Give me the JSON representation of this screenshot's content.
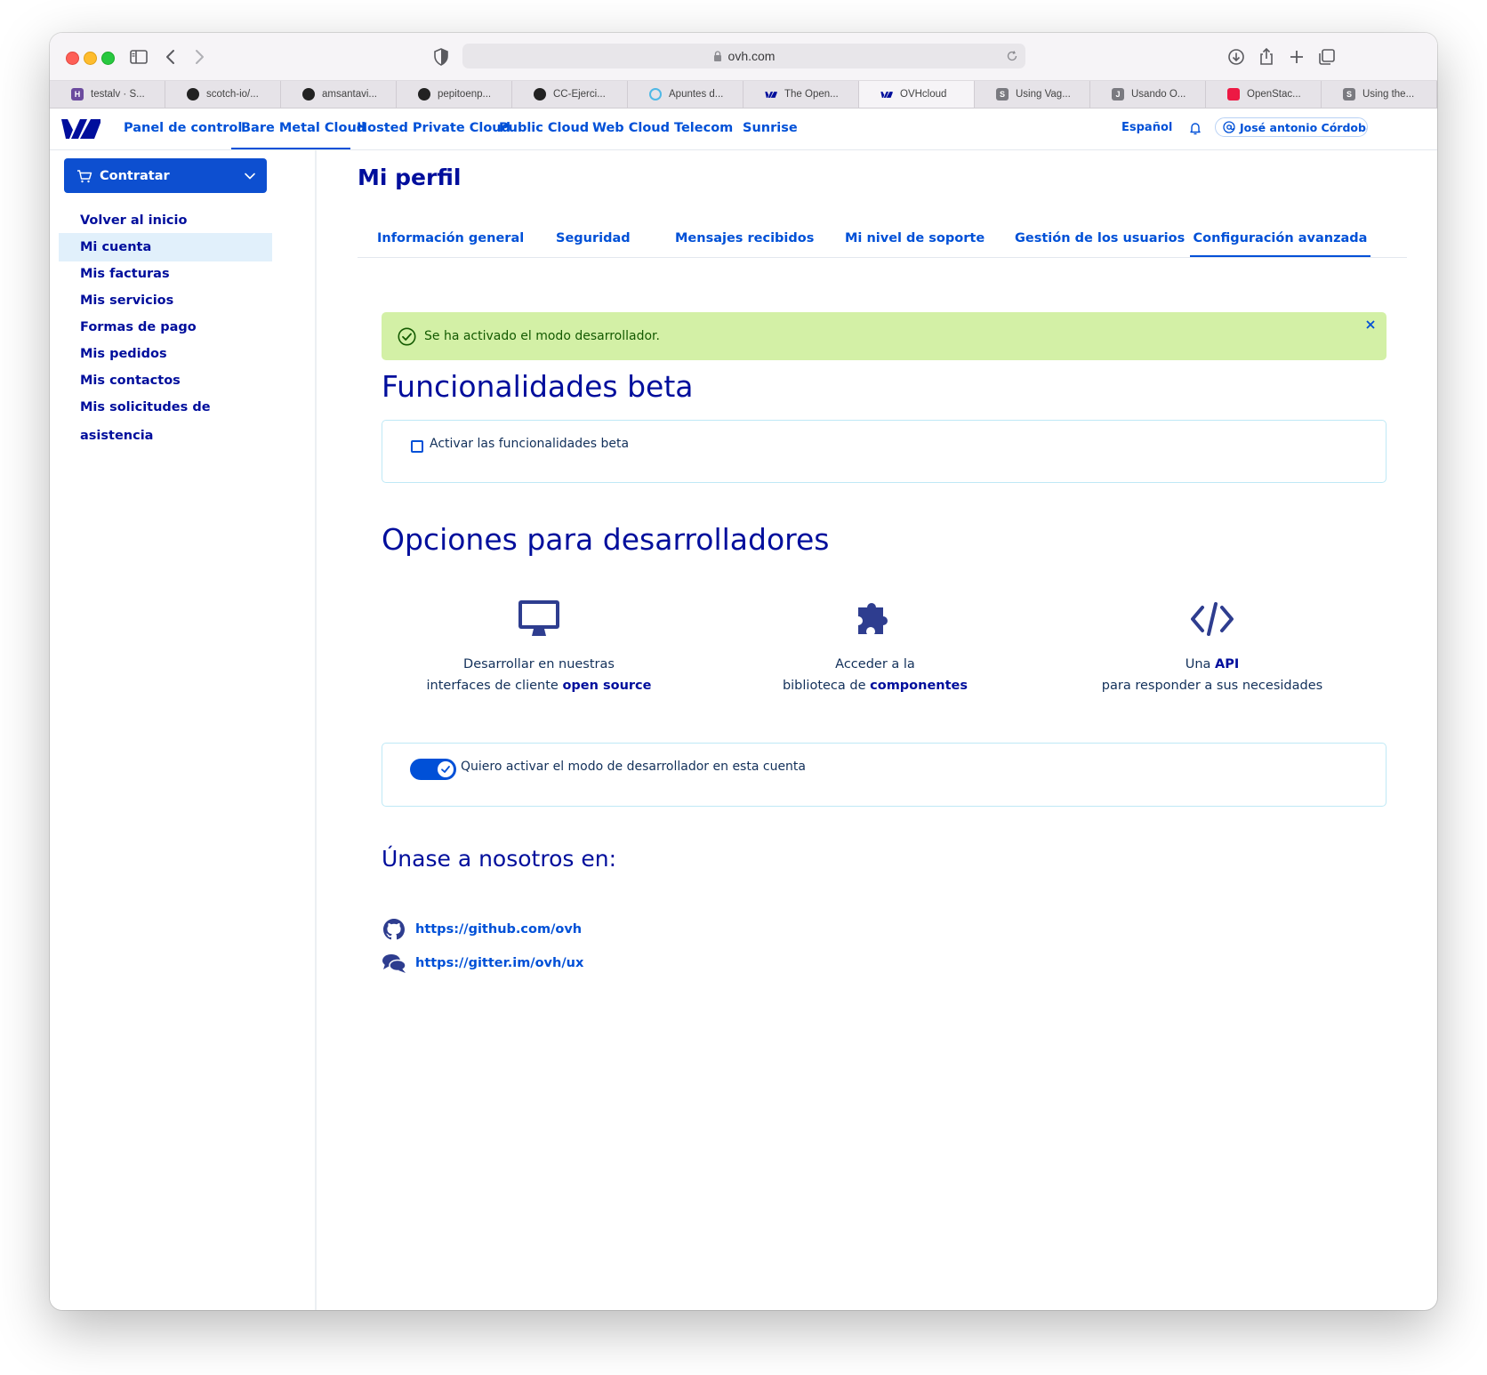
{
  "browser": {
    "url": "ovh.com",
    "tabs": [
      {
        "title": "testalv · S...",
        "favicon": "heroku-icon",
        "color": "#6b4a9e",
        "letter": "H"
      },
      {
        "title": "scotch-io/...",
        "favicon": "github-icon",
        "color": "#222222",
        "letter": ""
      },
      {
        "title": "amsantavi...",
        "favicon": "github-icon",
        "color": "#222222",
        "letter": ""
      },
      {
        "title": "pepitoenp...",
        "favicon": "github-icon",
        "color": "#222222",
        "letter": ""
      },
      {
        "title": "CC-Ejerci...",
        "favicon": "github-icon",
        "color": "#222222",
        "letter": ""
      },
      {
        "title": "Apuntes d...",
        "favicon": "cloud-icon",
        "color": "#4fb8e6",
        "letter": ""
      },
      {
        "title": "The Open...",
        "favicon": "ovh-icon",
        "color": "#000e9c",
        "letter": ""
      },
      {
        "title": "OVHcloud",
        "favicon": "ovh-icon",
        "color": "#000e9c",
        "letter": "",
        "active": true
      },
      {
        "title": "Using Vag...",
        "favicon": "s-icon",
        "color": "#7a7a80",
        "letter": "S"
      },
      {
        "title": "Usando O...",
        "favicon": "j-icon",
        "color": "#7a7a80",
        "letter": "J"
      },
      {
        "title": "OpenStac...",
        "favicon": "openstack-icon",
        "color": "#ed1944",
        "letter": ""
      },
      {
        "title": "Using the...",
        "favicon": "s-icon",
        "color": "#7a7a80",
        "letter": "S"
      }
    ]
  },
  "topnav": {
    "items": [
      "Panel de control",
      "Bare Metal Cloud",
      "Hosted Private Cloud",
      "Public Cloud",
      "Web Cloud",
      "Telecom",
      "Sunrise"
    ],
    "active": "Bare Metal Cloud",
    "language": "Español",
    "user": "José antonio Córdoba..."
  },
  "sidebar": {
    "order_button": "Contratar",
    "items": [
      "Volver al inicio",
      "Mi cuenta",
      "Mis facturas",
      "Mis servicios",
      "Formas de pago",
      "Mis pedidos",
      "Mis contactos",
      "Mis solicitudes de asistencia"
    ],
    "active": "Mi cuenta"
  },
  "main": {
    "title": "Mi perfil",
    "tabs": [
      "Información general",
      "Seguridad",
      "Mensajes recibidos",
      "Mi nivel de soporte",
      "Gestión de los usuarios",
      "Configuración avanzada"
    ],
    "active_tab": "Configuración avanzada",
    "alert": "Se ha activado el modo desarrollador.",
    "beta_title": "Funcionalidades beta",
    "beta_checkbox_label": "Activar las funcionalidades beta",
    "beta_checked": false,
    "dev_title": "Opciones para desarrolladores",
    "features": [
      {
        "line1": "Desarrollar en nuestras",
        "line2_pre": "interfaces de cliente ",
        "line2_bold": "open source",
        "icon": "monitor-icon"
      },
      {
        "line1": "Acceder a la",
        "line2_pre": "biblioteca de ",
        "line2_bold": "componentes",
        "icon": "puzzle-icon"
      },
      {
        "line1_pre": "Una ",
        "line1_bold": "API",
        "line2": "para responder a sus necesidades",
        "icon": "code-icon"
      }
    ],
    "dev_toggle_label": "Quiero activar el modo de desarrollador en esta cuenta",
    "dev_toggle_on": true,
    "join_title": "Únase a nosotros en:",
    "links": [
      {
        "text": "https://github.com/ovh",
        "icon": "github-icon"
      },
      {
        "text": "https://gitter.im/ovh/ux",
        "icon": "chat-icon"
      }
    ]
  },
  "colors": {
    "brand": "#000e9c",
    "link": "#0050d7",
    "success_bg": "#d3f0a6"
  }
}
